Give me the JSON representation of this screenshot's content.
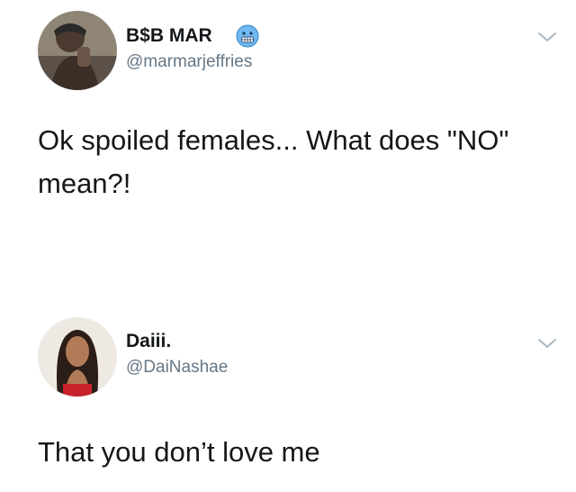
{
  "tweets": [
    {
      "display_name": "B$B MAR",
      "handle": "@marmarjeffries",
      "emoji": "cold-face-emoji",
      "text": "Ok spoiled females... What does \"NO\" mean?!"
    },
    {
      "display_name": "Daiii.",
      "handle": "@DaiNashae",
      "text": "That you don’t love me"
    }
  ],
  "colors": {
    "text_primary": "#14171a",
    "text_secondary": "#657786",
    "chevron": "#aab8c2",
    "emoji_face": "#6fb8f2"
  }
}
